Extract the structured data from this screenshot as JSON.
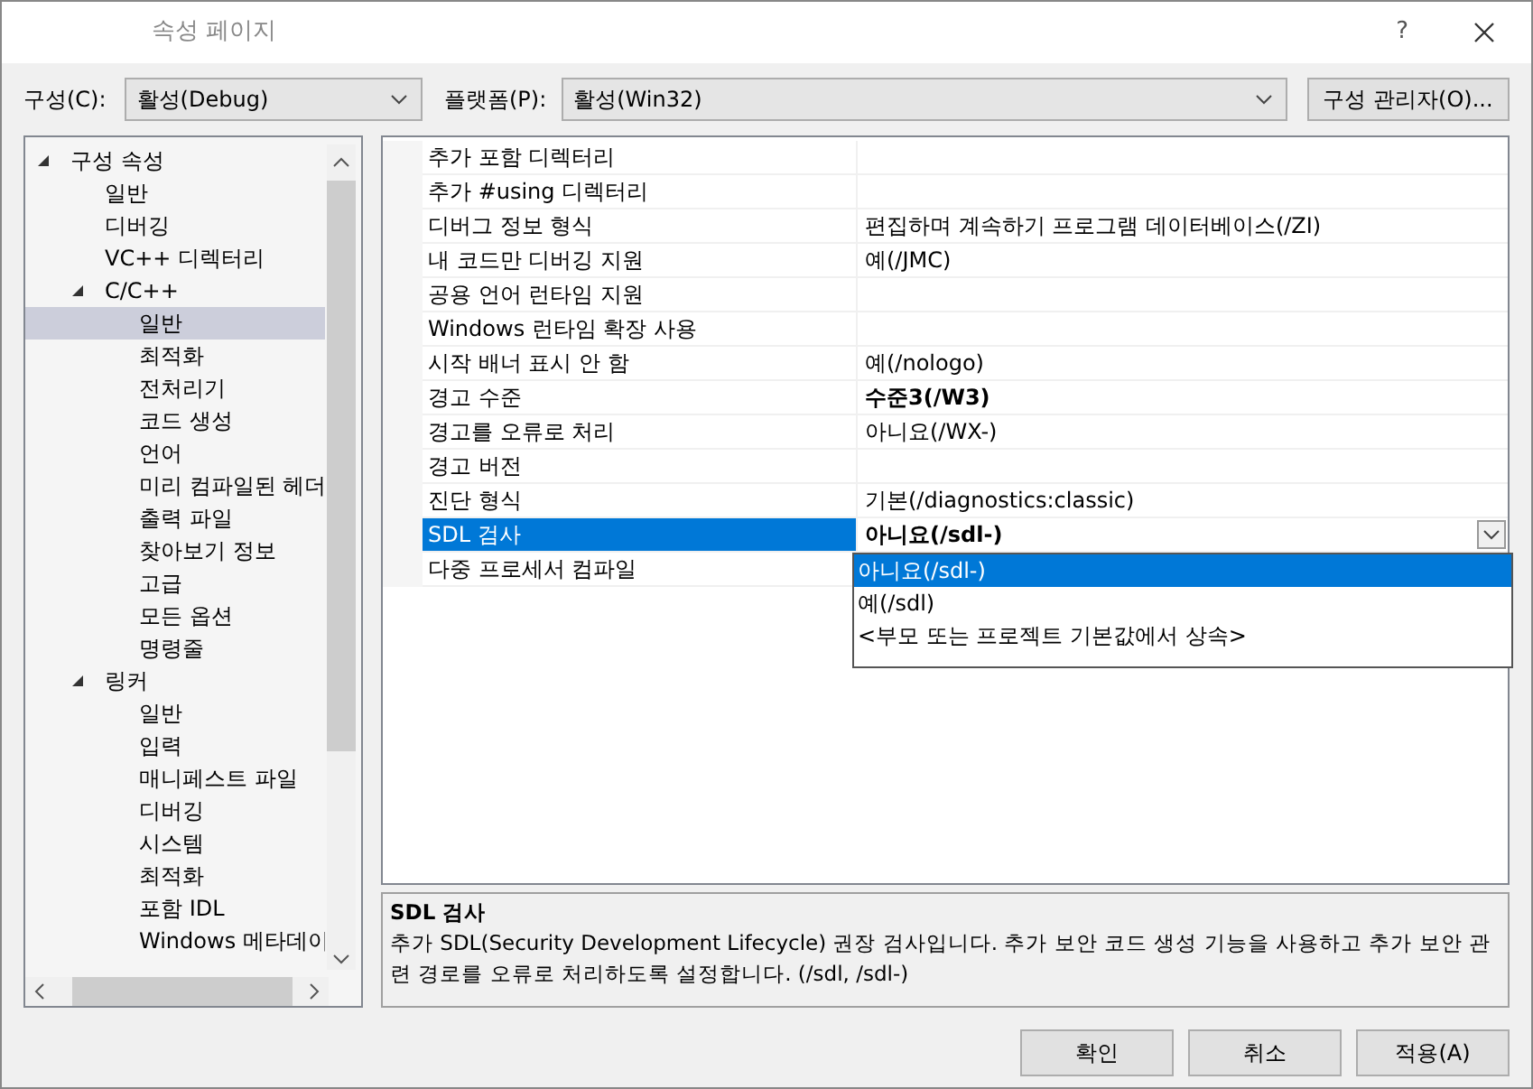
{
  "window": {
    "title": "속성 페이지",
    "help": "?"
  },
  "toolbar": {
    "configuration_label": "구성(C):",
    "configuration_value": "활성(Debug)",
    "platform_label": "플랫폼(P):",
    "platform_value": "활성(Win32)",
    "manager_button": "구성 관리자(O)..."
  },
  "tree": [
    {
      "label": "구성 속성",
      "expanded": true,
      "selected": false,
      "children": [
        {
          "label": "일반",
          "selected": false
        },
        {
          "label": "디버깅",
          "selected": false
        },
        {
          "label": "VC++ 디렉터리",
          "selected": false
        },
        {
          "label": "C/C++",
          "expanded": true,
          "selected": false,
          "children": [
            {
              "label": "일반",
              "selected": true
            },
            {
              "label": "최적화",
              "selected": false
            },
            {
              "label": "전처리기",
              "selected": false
            },
            {
              "label": "코드 생성",
              "selected": false
            },
            {
              "label": "언어",
              "selected": false
            },
            {
              "label": "미리 컴파일된 헤더",
              "selected": false
            },
            {
              "label": "출력 파일",
              "selected": false
            },
            {
              "label": "찾아보기 정보",
              "selected": false
            },
            {
              "label": "고급",
              "selected": false
            },
            {
              "label": "모든 옵션",
              "selected": false
            },
            {
              "label": "명령줄",
              "selected": false
            }
          ]
        },
        {
          "label": "링커",
          "expanded": true,
          "selected": false,
          "children": [
            {
              "label": "일반",
              "selected": false
            },
            {
              "label": "입력",
              "selected": false
            },
            {
              "label": "매니페스트 파일",
              "selected": false
            },
            {
              "label": "디버깅",
              "selected": false
            },
            {
              "label": "시스템",
              "selected": false
            },
            {
              "label": "최적화",
              "selected": false
            },
            {
              "label": "포함 IDL",
              "selected": false
            },
            {
              "label": "Windows 메타데이",
              "selected": false
            }
          ]
        }
      ]
    }
  ],
  "properties": [
    {
      "name": "추가 포함 디렉터리",
      "selected": false
    },
    {
      "name": "추가 #using 디렉터리",
      "selected": false
    },
    {
      "name": "디버그 정보 형식",
      "value": "편집하며 계속하기 프로그램 데이터베이스(/ZI)",
      "bold": false,
      "selected": false
    },
    {
      "name": "내 코드만 디버깅 지원",
      "value": "예(/JMC)",
      "bold": false,
      "selected": false
    },
    {
      "name": "공용 언어 런타임 지원",
      "selected": false
    },
    {
      "name": "Windows 런타임 확장 사용",
      "selected": false
    },
    {
      "name": "시작 배너 표시 안 함",
      "value": "예(/nologo)",
      "bold": false,
      "selected": false
    },
    {
      "name": "경고 수준",
      "value": "수준3(/W3)",
      "bold": true,
      "selected": false
    },
    {
      "name": "경고를 오류로 처리",
      "value": "아니요(/WX-)",
      "bold": false,
      "selected": false
    },
    {
      "name": "경고 버전",
      "selected": false
    },
    {
      "name": "진단 형식",
      "value": "기본(/diagnostics:classic)",
      "bold": false,
      "selected": false
    },
    {
      "name": "SDL 검사",
      "value": "아니요(/sdl-)",
      "bold": true,
      "selected": true
    },
    {
      "name": "다중 프로세서 컴파일",
      "selected": false
    }
  ],
  "dropdown": {
    "options": [
      {
        "label": "아니요(/sdl-)",
        "selected": true
      },
      {
        "label": "예(/sdl)",
        "selected": false
      },
      {
        "label": "<부모 또는 프로젝트 기본값에서 상속>",
        "selected": false
      }
    ]
  },
  "description": {
    "title": "SDL 검사",
    "text": "추가 SDL(Security Development Lifecycle) 권장 검사입니다. 추가 보안 코드 생성 기능을 사용하고 추가 보안 관련 경로를 오류로 처리하도록 설정합니다. (/sdl, /sdl-)"
  },
  "buttons": [
    "확인",
    "취소",
    "적용(A)"
  ]
}
